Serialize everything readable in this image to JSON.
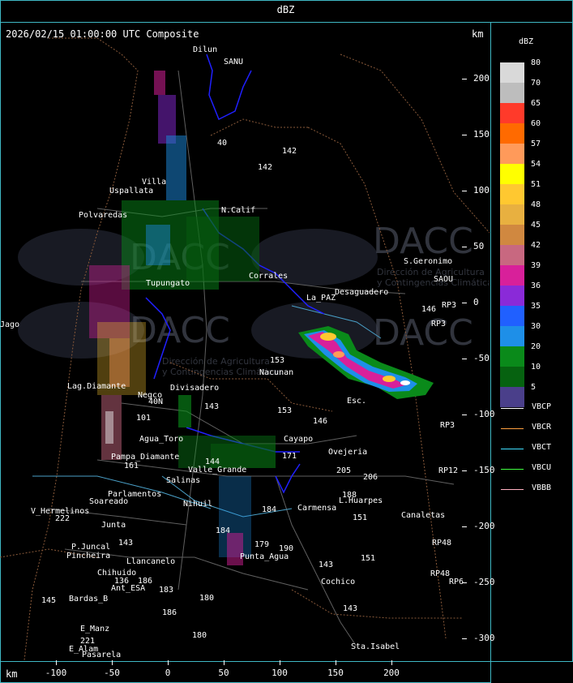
{
  "header": {
    "title": "dBZ"
  },
  "map": {
    "title": "2026/02/15 01:00:00 UTC Composite",
    "unit_top": "km",
    "unit_bottom": "km",
    "y_ticks": [
      "200",
      "150",
      "100",
      "50",
      "0",
      "-50",
      "-100",
      "-150",
      "-200",
      "-250",
      "-300"
    ],
    "x_ticks": [
      "-100",
      "-50",
      "0",
      "50",
      "100",
      "150",
      "200"
    ],
    "watermark": {
      "brand": "DACC",
      "line1": "Dirección de Agricultura",
      "line2": "y Contingencias Climáticas"
    },
    "places": [
      "Dilun",
      "SANU",
      "Villa",
      "Uspallata",
      "Polvaredas",
      "N.Calif",
      "S.Geronimo",
      "SAOU",
      "Desaguadero",
      "La_PAZ",
      "Corrales",
      "Nacunan",
      "Tupungato",
      "Lag.Diamante",
      "Negco",
      "Divisadero",
      "Esc.",
      "Agua_Toro",
      "Pampa_Diamante",
      "Valle_Grande",
      "Salinas",
      "Nihuil",
      "Soareado",
      "Parlamentos",
      "V_Hermelinos",
      "Junta",
      "Ovejeria",
      "L.Huarpes",
      "Canaletas",
      "P.Juncal",
      "Pincheira",
      "Llancanelo",
      "Chihuido",
      "Ant_ESA",
      "Bardas_B",
      "E_Manz",
      "E_Alam",
      "Pasarela",
      "Punta_Agua",
      "Carmensa",
      "Cochico",
      "Sta.Isabel",
      "Jago",
      "Cayapo"
    ],
    "route_numbers": [
      "40",
      "142",
      "142",
      "146",
      "153",
      "153",
      "143",
      "146",
      "171",
      "205",
      "206",
      "188",
      "151",
      "151",
      "143",
      "143",
      "184",
      "184",
      "179",
      "190",
      "144",
      "101",
      "145",
      "221",
      "40N",
      "180",
      "183",
      "186",
      "186",
      "136",
      "143",
      "180",
      "RP3",
      "RP3",
      "RP3",
      "RP12",
      "RP48",
      "RP48",
      "RP6",
      "222",
      "161"
    ]
  },
  "legend": {
    "unit": "dBZ",
    "levels": [
      {
        "value": "80",
        "color": "#d9d9d9"
      },
      {
        "value": "70",
        "color": "#bdbdbd"
      },
      {
        "value": "65",
        "color": "#ff3a2a"
      },
      {
        "value": "60",
        "color": "#ff6a00"
      },
      {
        "value": "57",
        "color": "#ff9a5a"
      },
      {
        "value": "54",
        "color": "#ffff00"
      },
      {
        "value": "51",
        "color": "#ffc830"
      },
      {
        "value": "48",
        "color": "#e8b040"
      },
      {
        "value": "45",
        "color": "#d08840"
      },
      {
        "value": "42",
        "color": "#c86880"
      },
      {
        "value": "39",
        "color": "#d8209a"
      },
      {
        "value": "36",
        "color": "#8a2ad8"
      },
      {
        "value": "35",
        "color": "#2060ff"
      },
      {
        "value": "30",
        "color": "#1e8fe8"
      },
      {
        "value": "20",
        "color": "#0a8a1a"
      },
      {
        "value": "10",
        "color": "#066210"
      },
      {
        "value": "5",
        "color": "#4a3f8a"
      }
    ],
    "networks": [
      {
        "name": "VBCP",
        "color": "#ffffff"
      },
      {
        "name": "VBCR",
        "color": "#ffa040"
      },
      {
        "name": "VBCT",
        "color": "#40e0ff"
      },
      {
        "name": "VBCU",
        "color": "#40ff40"
      },
      {
        "name": "VBBB",
        "color": "#ffb0c0"
      }
    ]
  }
}
